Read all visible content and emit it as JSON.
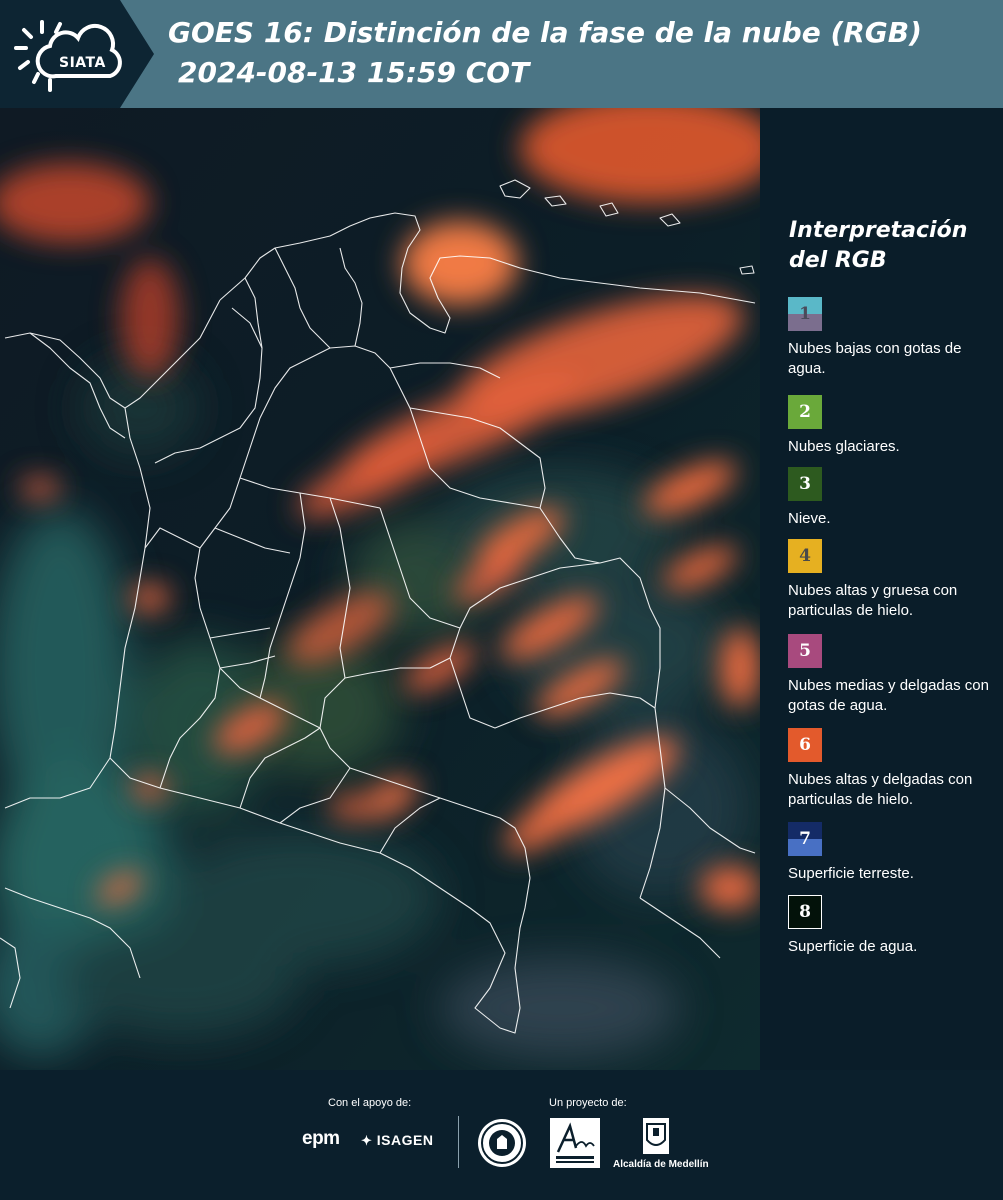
{
  "header": {
    "logo_text": "SIATA",
    "title": "GOES 16: Distinción de la fase de la nube (RGB)",
    "subtitle": "2024-08-13 15:59 COT"
  },
  "legend": {
    "title_line1": "Interpretación",
    "title_line2": "del RGB",
    "items": [
      {
        "number": "1",
        "label": "Nubes bajas con gotas de agua.",
        "color_top": "#5ab8c8",
        "color_bottom": "#7b6e8e",
        "number_color": "#4a4a5a"
      },
      {
        "number": "2",
        "label": "Nubes glaciares.",
        "color_top": "#6aa93a",
        "color_bottom": "#6aa93a",
        "number_color": "#ffffff"
      },
      {
        "number": "3",
        "label": "Nieve.",
        "color_top": "#2d5a1f",
        "color_bottom": "#2d5a1f",
        "number_color": "#ffffff"
      },
      {
        "number": "4",
        "label": "Nubes altas y gruesa con particulas de hielo.",
        "color_top": "#e6b021",
        "color_bottom": "#e6b021",
        "number_color": "#4a4a4a"
      },
      {
        "number": "5",
        "label": "Nubes medias y delgadas con gotas de agua.",
        "color_top": "#a84a7e",
        "color_bottom": "#a84a7e",
        "number_color": "#ffffff"
      },
      {
        "number": "6",
        "label": "Nubes altas y delgadas con particulas de hielo.",
        "color_top": "#e35a2c",
        "color_bottom": "#e35a2c",
        "number_color": "#ffffff"
      },
      {
        "number": "7",
        "label": "Superficie terreste.",
        "color_top": "#142b66",
        "color_bottom": "#4870c4",
        "number_color": "#ffffff"
      },
      {
        "number": "8",
        "label": "Superficie de agua.",
        "color_top": "#03120a",
        "color_bottom": "#03120a",
        "number_color": "#ffffff"
      }
    ]
  },
  "footer": {
    "support_label": "Con el apoyo de:",
    "project_label": "Un proyecto de:",
    "epm": "epm",
    "isagen": "ISAGEN",
    "alcaldia": "Alcaldía de Medellín"
  }
}
